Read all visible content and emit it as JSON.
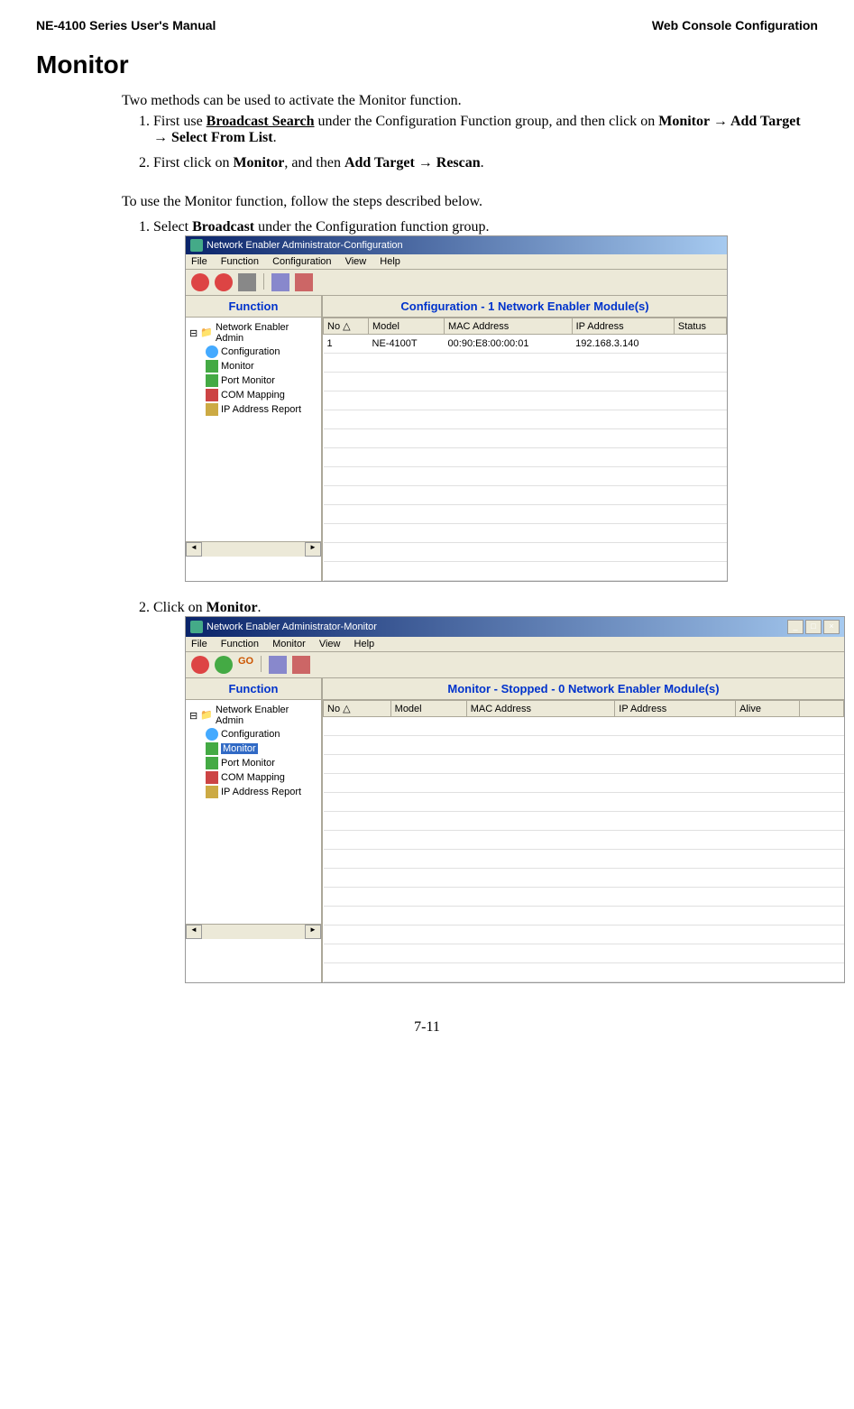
{
  "header": {
    "left": "NE-4100 Series User's Manual",
    "right": "Web Console Configuration"
  },
  "title": "Monitor",
  "intro": "Two methods can be used to activate the Monitor function.",
  "methods": [
    {
      "prefix": "First use ",
      "bold1": "Broadcast Search",
      "mid": " under the Configuration Function group, and then click on ",
      "bold2": "Monitor → Add Target → Select From List",
      "suffix": "."
    },
    {
      "prefix": "First click on ",
      "bold1": "Monitor",
      "mid": ", and then ",
      "bold2": "Add Target → Rescan",
      "suffix": "."
    }
  ],
  "second_intro": "To use the Monitor function, follow the steps described below.",
  "steps": [
    {
      "prefix": "Select ",
      "bold": "Broadcast",
      "suffix": " under the Configuration function group."
    },
    {
      "prefix": "Click on ",
      "bold": "Monitor",
      "suffix": "."
    }
  ],
  "screenshot1": {
    "title": "Network Enabler Administrator-Configuration",
    "menubar": [
      "File",
      "Function",
      "Configuration",
      "View",
      "Help"
    ],
    "sidebar_header": "Function",
    "tree_root": "Network Enabler Admin",
    "tree_items": [
      "Configuration",
      "Monitor",
      "Port Monitor",
      "COM Mapping",
      "IP Address Report"
    ],
    "content_header": "Configuration - 1 Network Enabler Module(s)",
    "columns": [
      "No",
      "Model",
      "MAC Address",
      "IP Address",
      "Status"
    ],
    "rows": [
      {
        "no": "1",
        "model": "NE-4100T",
        "mac": "00:90:E8:00:00:01",
        "ip": "192.168.3.140",
        "status": ""
      }
    ]
  },
  "screenshot2": {
    "title": "Network Enabler Administrator-Monitor",
    "menubar": [
      "File",
      "Function",
      "Monitor",
      "View",
      "Help"
    ],
    "go_label": "GO",
    "sidebar_header": "Function",
    "tree_root": "Network Enabler Admin",
    "tree_items": [
      "Configuration",
      "Monitor",
      "Port Monitor",
      "COM Mapping",
      "IP Address Report"
    ],
    "selected": "Monitor",
    "content_header": "Monitor - Stopped - 0 Network Enabler Module(s)",
    "columns": [
      "No",
      "Model",
      "MAC Address",
      "IP Address",
      "Alive"
    ]
  },
  "page_number": "7-11"
}
